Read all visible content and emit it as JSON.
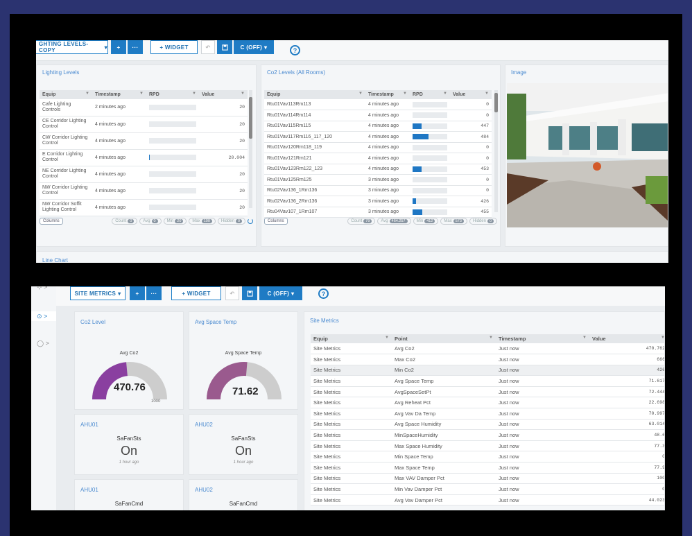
{
  "top": {
    "toolbar": {
      "dashboard_menu": "GHTING LEVELS-COPY",
      "add": "+",
      "more": "···",
      "widget": "+ WIDGET",
      "undo": "↶",
      "save": "💾",
      "refresh": "C (OFF)",
      "help": "?"
    },
    "lighting": {
      "title": "Lighting Levels",
      "headers": [
        "Equip",
        "Timestamp",
        "RPD",
        "Value"
      ],
      "rows": [
        {
          "equip": "Cafe Lighting Controls",
          "ts": "2 minutes ago",
          "pct": 0,
          "value": "20"
        },
        {
          "equip": "CE Corridor Lighting Control",
          "ts": "4 minutes ago",
          "pct": 0,
          "value": "20"
        },
        {
          "equip": "CW Corridor Lighting Control",
          "ts": "4 minutes ago",
          "pct": 0,
          "value": "20"
        },
        {
          "equip": "E Corridor Lighting Control",
          "ts": "4 minutes ago",
          "pct": 2,
          "value": "20.004"
        },
        {
          "equip": "NE Corridor Lighting Control",
          "ts": "4 minutes ago",
          "pct": 0,
          "value": "20"
        },
        {
          "equip": "NW Corridor Lighting Control",
          "ts": "4 minutes ago",
          "pct": 0,
          "value": "20"
        },
        {
          "equip": "NW Corridor Soffit Lighting Control",
          "ts": "4 minutes ago",
          "pct": 0,
          "value": "20"
        }
      ],
      "footer": {
        "columns": "Columns",
        "count": "Count",
        "count_v": "0",
        "avg": "Avg",
        "avg_v": "0",
        "min": "Min",
        "min_v": "20",
        "max": "Max",
        "max_v": "100",
        "hidden": "Hidden",
        "hidden_v": "0"
      }
    },
    "co2": {
      "title": "Co2 Levels (All Rooms)",
      "headers": [
        "Equip",
        "Timestamp",
        "RPD",
        "Value"
      ],
      "rows": [
        {
          "equip": "Rtu01Vav113Rm113",
          "ts": "4 minutes ago",
          "pct": 0,
          "value": "0"
        },
        {
          "equip": "Rtu01Vav114Rm114",
          "ts": "4 minutes ago",
          "pct": 0,
          "value": "0"
        },
        {
          "equip": "Rtu01Vav115Rm115",
          "ts": "4 minutes ago",
          "pct": 25,
          "value": "447"
        },
        {
          "equip": "Rtu01Vav117Rm116_117_120",
          "ts": "4 minutes ago",
          "pct": 45,
          "value": "484"
        },
        {
          "equip": "Rtu01Vav120Rm118_119",
          "ts": "4 minutes ago",
          "pct": 0,
          "value": "0"
        },
        {
          "equip": "Rtu01Vav121Rm121",
          "ts": "4 minutes ago",
          "pct": 0,
          "value": "0"
        },
        {
          "equip": "Rtu01Vav123Rm122_123",
          "ts": "4 minutes ago",
          "pct": 25,
          "value": "453"
        },
        {
          "equip": "Rtu01Vav125Rm125",
          "ts": "3 minutes ago",
          "pct": 0,
          "value": "0"
        },
        {
          "equip": "Rtu02Vav136_1Rm136",
          "ts": "3 minutes ago",
          "pct": 0,
          "value": "0"
        },
        {
          "equip": "Rtu02Vav136_2Rm136",
          "ts": "3 minutes ago",
          "pct": 10,
          "value": "426"
        },
        {
          "equip": "Rtu04Vav107_1Rm107",
          "ts": "3 minutes ago",
          "pct": 28,
          "value": "455"
        }
      ],
      "footer": {
        "columns": "Columns",
        "count": "Count",
        "count_v": "79",
        "avg": "Avg",
        "avg_v": "464.257",
        "min": "Min",
        "min_v": "412",
        "max": "Max",
        "max_v": "573",
        "hidden": "Hidden",
        "hidden_v": "0"
      }
    },
    "image": {
      "title": "Image"
    },
    "line_chart": {
      "title": "Line Chart"
    }
  },
  "bottom": {
    "toolbar": {
      "dashboard_menu": "SITE METRICS",
      "add": "+",
      "more": "···",
      "widget": "+ WIDGET",
      "undo": "↶",
      "save": "💾",
      "refresh": "C (OFF)",
      "help": "?"
    },
    "gauges": {
      "co2": {
        "title": "Co2 Level",
        "label": "Avg Co2",
        "value": "470.76",
        "value_num": 470.76,
        "max": 1000,
        "max_label": "1000",
        "color": "#8a3fa0"
      },
      "temp": {
        "title": "Avg Space Temp",
        "label": "Avg Space Temp",
        "value": "71.62",
        "value_num": 71.62,
        "min": 40,
        "max": 100,
        "color": "#9a5a8e"
      }
    },
    "status": [
      {
        "title": "AHU01",
        "label": "SaFanSts",
        "state": "On",
        "time": "1 hour ago"
      },
      {
        "title": "AHU02",
        "label": "SaFanSts",
        "state": "On",
        "time": "1 hour ago"
      },
      {
        "title": "AHU01",
        "label": "SaFanCmd"
      },
      {
        "title": "AHU02",
        "label": "SaFanCmd"
      }
    ],
    "site_metrics": {
      "title": "Site Metrics",
      "headers": [
        "Equip",
        "Point",
        "Timestamp",
        "Value"
      ],
      "rows": [
        {
          "equip": "Site Metrics",
          "point": "Avg Co2",
          "ts": "Just now",
          "value": "470.762"
        },
        {
          "equip": "Site Metrics",
          "point": "Max Co2",
          "ts": "Just now",
          "value": "666"
        },
        {
          "equip": "Site Metrics",
          "point": "Min Co2",
          "ts": "Just now",
          "value": "426"
        },
        {
          "equip": "Site Metrics",
          "point": "Avg Space Temp",
          "ts": "Just now",
          "value": "71.617"
        },
        {
          "equip": "Site Metrics",
          "point": "AvgSpaceSetPt",
          "ts": "Just now",
          "value": "72.444"
        },
        {
          "equip": "Site Metrics",
          "point": "Avg Reheat Pct",
          "ts": "Just now",
          "value": "22.698"
        },
        {
          "equip": "Site Metrics",
          "point": "Avg Vav Da Temp",
          "ts": "Just now",
          "value": "70.997"
        },
        {
          "equip": "Site Metrics",
          "point": "Avg Space Humidity",
          "ts": "Just now",
          "value": "63.014"
        },
        {
          "equip": "Site Metrics",
          "point": "MinSpaceHumidity",
          "ts": "Just now",
          "value": "48.6"
        },
        {
          "equip": "Site Metrics",
          "point": "Max Space Humidity",
          "ts": "Just now",
          "value": "77.3"
        },
        {
          "equip": "Site Metrics",
          "point": "Min Space Temp",
          "ts": "Just now",
          "value": "0"
        },
        {
          "equip": "Site Metrics",
          "point": "Max Space Temp",
          "ts": "Just now",
          "value": "77.9"
        },
        {
          "equip": "Site Metrics",
          "point": "Max VAV Damper Pct",
          "ts": "Just now",
          "value": "100"
        },
        {
          "equip": "Site Metrics",
          "point": "Min Vav Damper Pct",
          "ts": "Just now",
          "value": "0"
        },
        {
          "equip": "Site Metrics",
          "point": "Avg Vav Damper Pct",
          "ts": "Just now",
          "value": "44.023"
        }
      ]
    },
    "sidebar": {
      "item1": "⊙ >",
      "item2": "◯ >",
      "item0": "⊹ >"
    }
  }
}
